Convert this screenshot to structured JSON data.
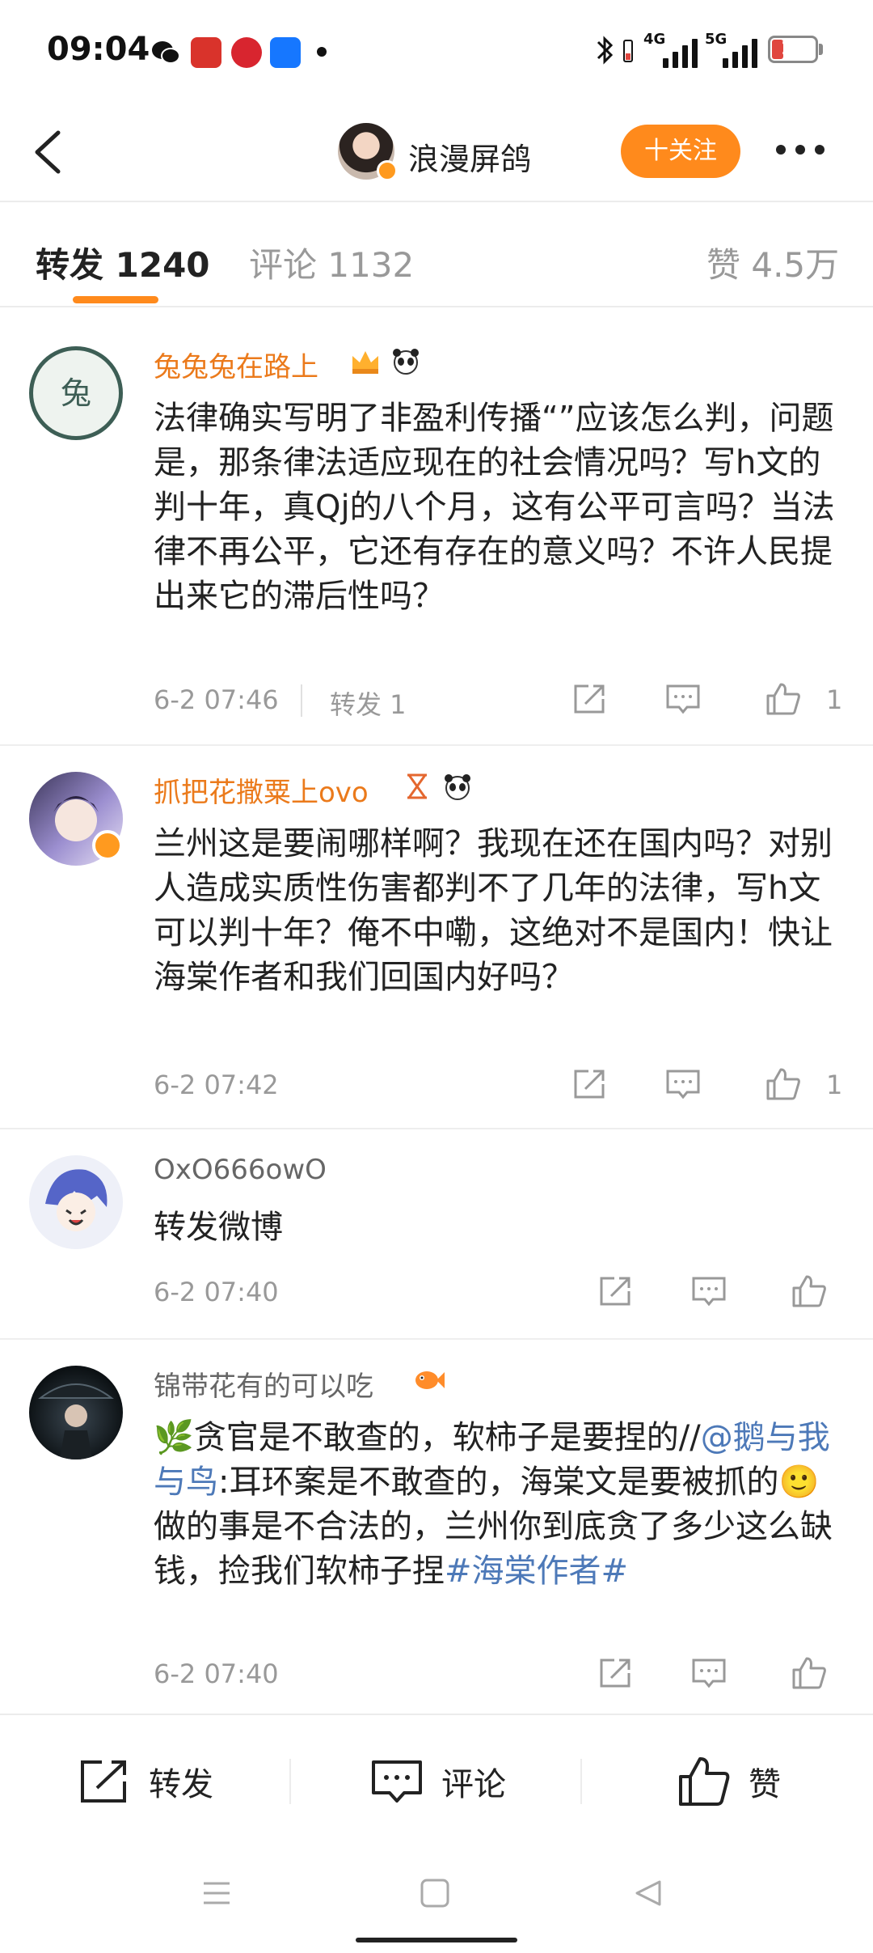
{
  "status_bar": {
    "time": "09:04",
    "apps": [
      "wechat-icon",
      "qidian-icon",
      "huawei-icon",
      "alipay-icon"
    ],
    "signal_4g": "4G",
    "signal_5g": "5G",
    "battery": "19"
  },
  "header": {
    "user_name": "浪漫屏鸽",
    "follow_label": "十关注"
  },
  "tabs": {
    "repost": "转发 1240",
    "comment": "评论 1132",
    "like": "赞 4.5万"
  },
  "comments": [
    {
      "name": "兔兔兔在路上",
      "text": "法律确实写明了非盈利传播“”应该怎么判，问题是，那条律法适应现在的社会情况吗？写h文的判十年，真Qj的八个月，这有公平可言吗？当法律不再公平，它还有存在的意义吗？不许人民提出来它的滞后性吗？",
      "time": "6-2 07:46",
      "repost": "转发 1",
      "likes": "1"
    },
    {
      "name": "抓把花撒粟上ovo",
      "text": "兰州这是要闹哪样啊？我现在还在国内吗？对别人造成实质性伤害都判不了几年的法律，写h文可以判十年？俺不中嘞，这绝对不是国内！快让海棠作者和我们回国内好吗？",
      "time": "6-2 07:42",
      "likes": "1"
    },
    {
      "name": "OxO666owO",
      "text": "转发微博",
      "time": "6-2 07:40"
    },
    {
      "name": "锦带花有的可以吃",
      "text_a": "🌿贪官是不敢查的，软柿子是要捏的//",
      "mention": "@鹅与我与鸟",
      "text_b": ":耳环案是不敢查的，海棠文是要被抓的🙂做的事是不合法的，兰州你到底贪了多少这么缺钱，捡我们软柿子捏",
      "hashtag": "#海棠作者#",
      "time": "6-2 07:40"
    }
  ],
  "bottom_bar": {
    "repost": "转发",
    "comment": "评论",
    "like": "赞"
  }
}
